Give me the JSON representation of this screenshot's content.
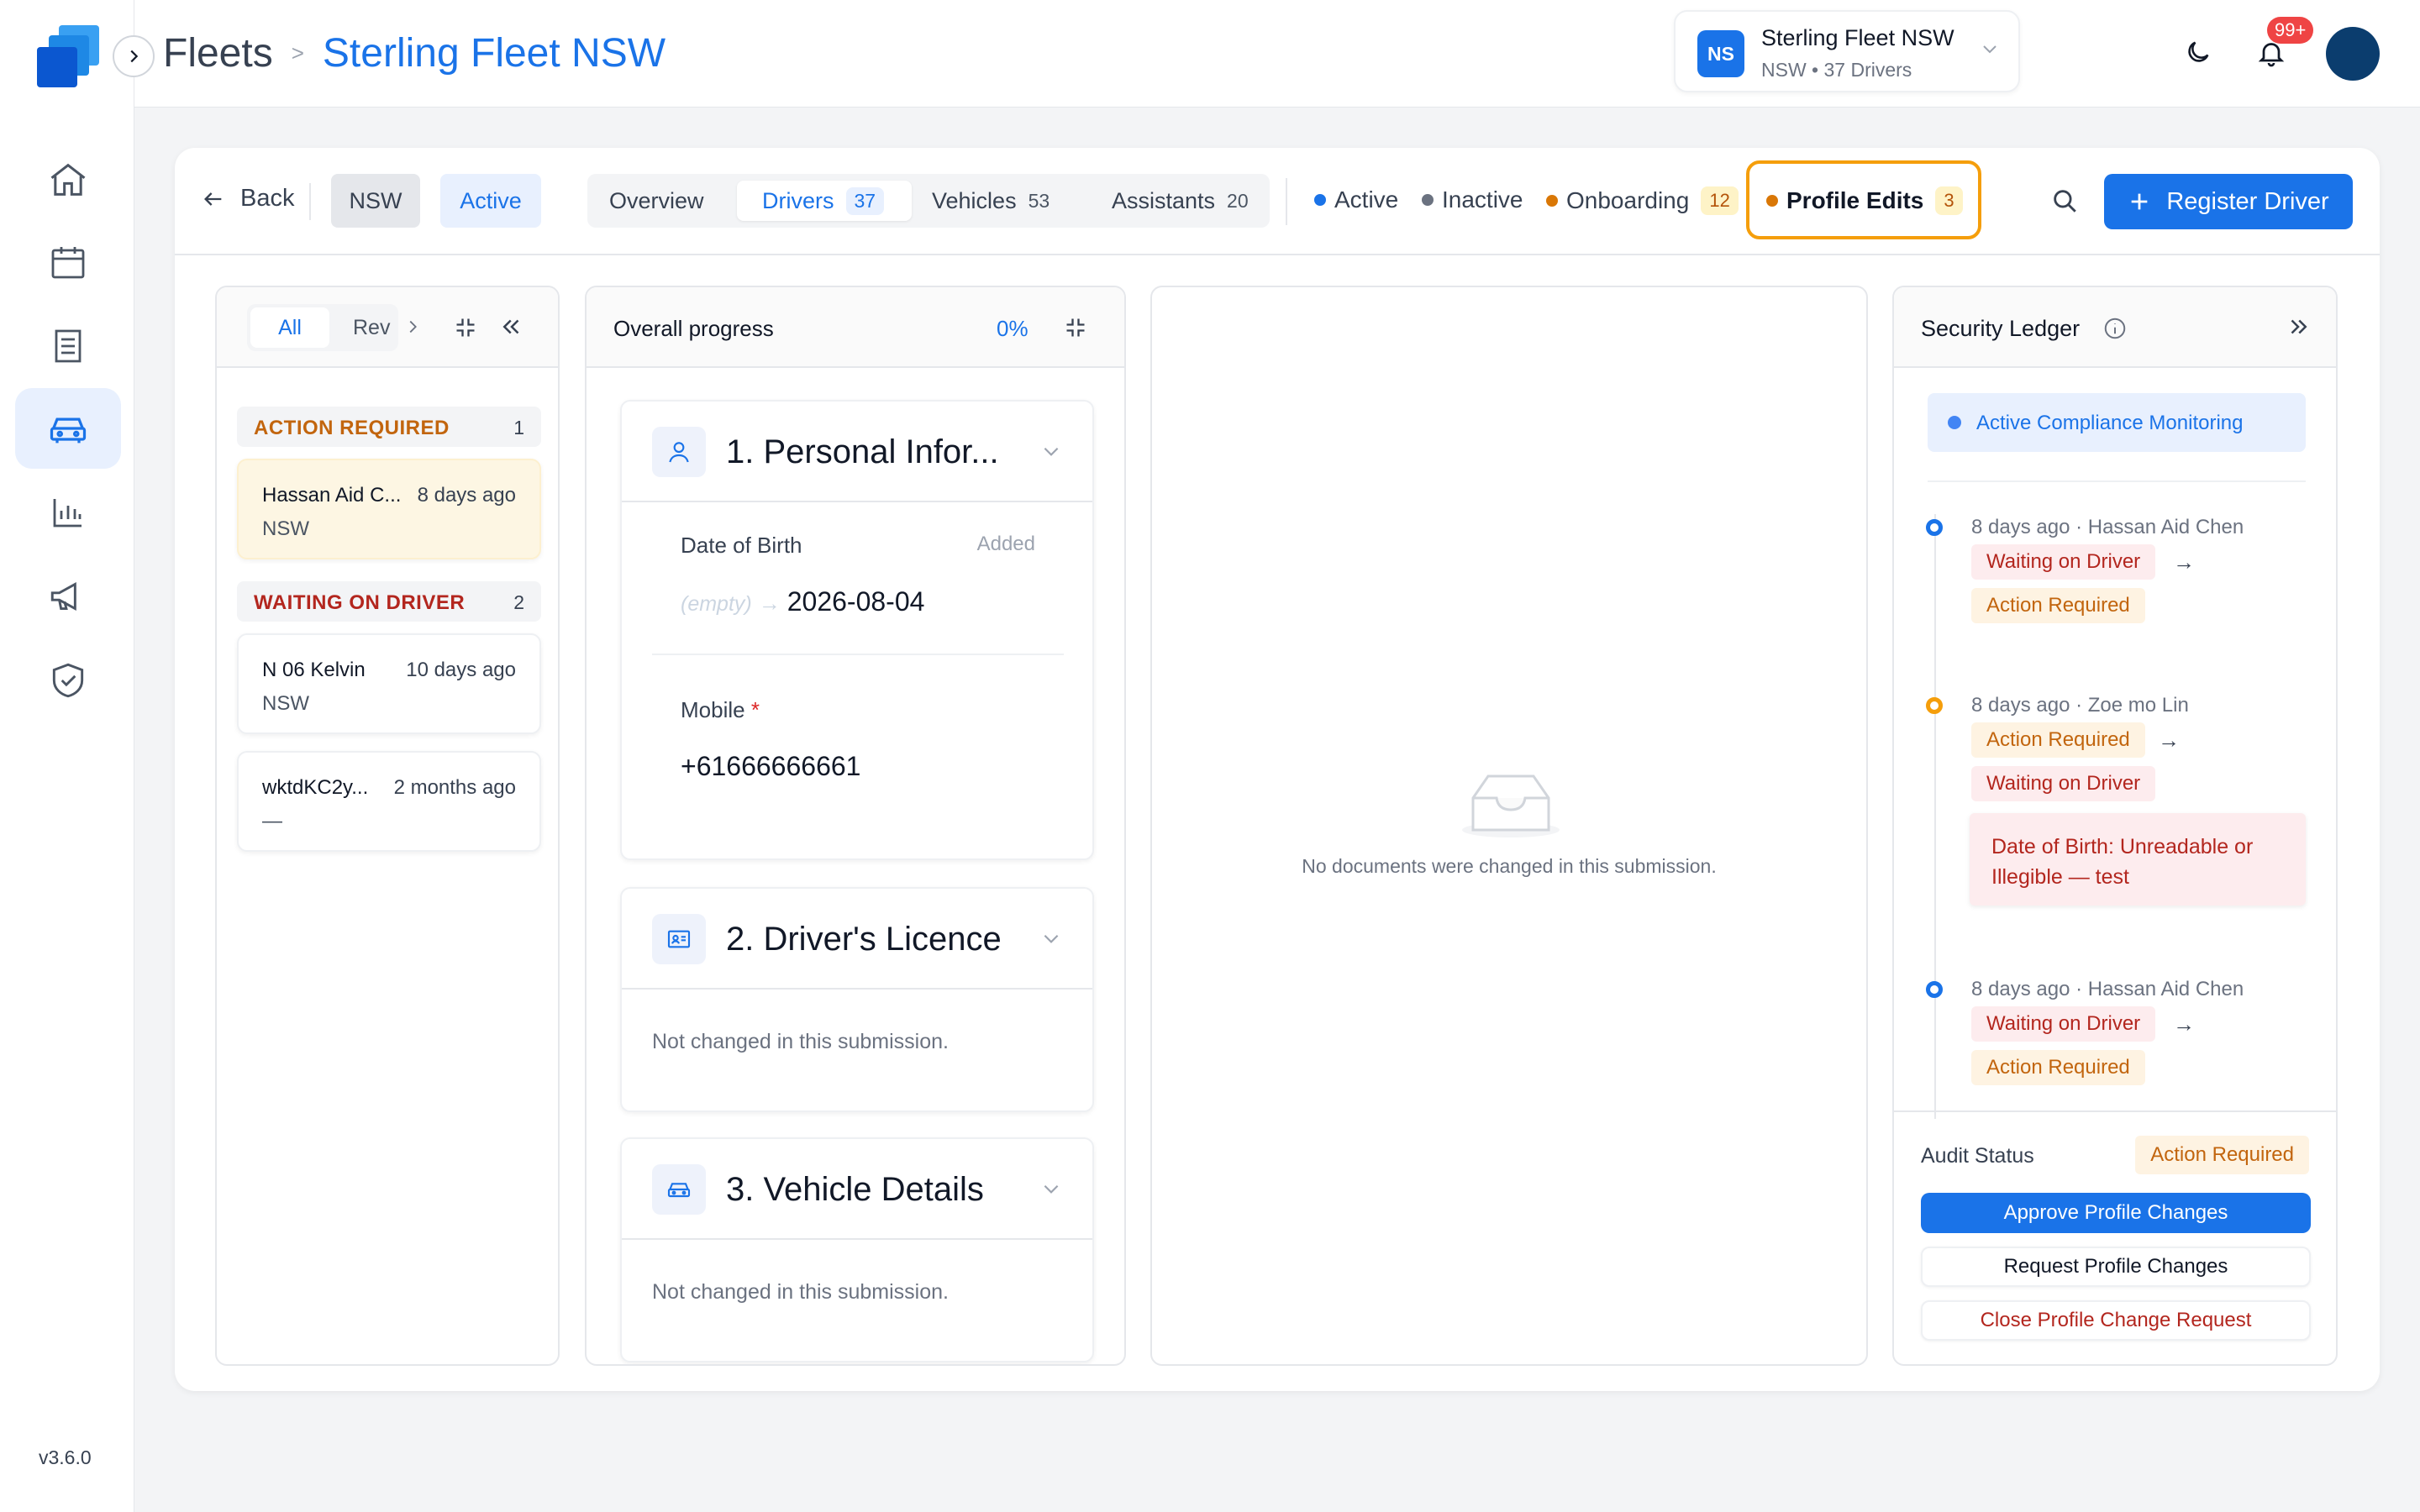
{
  "app": {
    "version": "v3.6.0",
    "notifications": "99+"
  },
  "breadcrumb": {
    "root": "Fleets",
    "sep": ">",
    "current": "Sterling Fleet NSW"
  },
  "fleet_switcher": {
    "badge": "NS",
    "name": "Sterling Fleet NSW",
    "sub": "NSW • 37 Drivers"
  },
  "toolbar": {
    "back": "Back",
    "chips": {
      "region": "NSW",
      "status": "Active"
    },
    "tabs": [
      {
        "label": "Overview",
        "count": ""
      },
      {
        "label": "Drivers",
        "count": "37"
      },
      {
        "label": "Vehicles",
        "count": "53"
      },
      {
        "label": "Assistants",
        "count": "20"
      }
    ],
    "stats": [
      {
        "label": "Active",
        "count": "",
        "color": "#1a73e8"
      },
      {
        "label": "Inactive",
        "count": "",
        "color": "#6b7280"
      },
      {
        "label": "Onboarding",
        "count": "12",
        "color": "#d97706"
      },
      {
        "label": "Profile Edits",
        "count": "3",
        "color": "#d97706"
      }
    ],
    "register_label": "Register Driver"
  },
  "queue": {
    "filter_all": "All",
    "filter_rev": "Rev",
    "groups": [
      {
        "title": "ACTION REQUIRED",
        "count": "1",
        "color": "#c2650e",
        "items": [
          {
            "name": "Hassan Aid C...",
            "time": "8 days ago",
            "region": "NSW"
          }
        ]
      },
      {
        "title": "WAITING ON DRIVER",
        "count": "2",
        "color": "#b3261e",
        "items": [
          {
            "name": "N 06 Kelvin",
            "time": "10 days ago",
            "region": "NSW"
          },
          {
            "name": "wktdKC2y...",
            "time": "2 months ago",
            "region": "—"
          }
        ]
      }
    ]
  },
  "progress": {
    "title": "Overall progress",
    "percent": "0%",
    "sections": [
      {
        "title": "1. Personal Infor...",
        "fields": [
          {
            "label": "Date of Birth",
            "status": "Added",
            "old": "(empty)",
            "arrow": "→",
            "value": "2026-08-04"
          },
          {
            "label": "Mobile",
            "required": "*",
            "value": "+61666666661"
          }
        ]
      },
      {
        "title": "2. Driver's Licence",
        "note": "Not changed in this submission."
      },
      {
        "title": "3. Vehicle Details",
        "note": "Not changed in this submission."
      }
    ]
  },
  "documents": {
    "empty_text": "No documents were changed in this submission."
  },
  "ledger": {
    "title": "Security Ledger",
    "monitor": "Active Compliance Monitoring",
    "entries": [
      {
        "meta": "8 days ago · Hassan Aid Chen",
        "from": "Waiting on Driver",
        "to": "Action Required",
        "arrow": "→"
      },
      {
        "meta": "8 days ago · Zoe mo Lin",
        "from": "Action Required",
        "to": "Waiting on Driver",
        "arrow": "→",
        "note": "Date of Birth: Unreadable or Illegible — test"
      },
      {
        "meta": "8 days ago · Hassan Aid Chen",
        "from": "Waiting on Driver",
        "to": "Action Required",
        "arrow": "→"
      }
    ],
    "audit_label": "Audit Status",
    "audit_value": "Action Required",
    "buttons": {
      "approve": "Approve Profile Changes",
      "request": "Request Profile Changes",
      "close": "Close Profile Change Request"
    }
  }
}
